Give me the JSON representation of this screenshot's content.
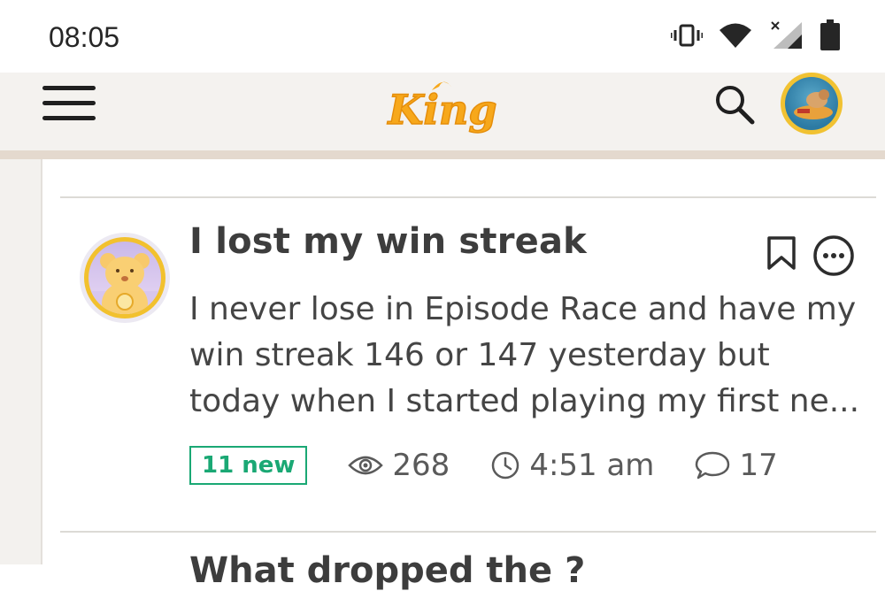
{
  "status_bar": {
    "time": "08:05",
    "icons": [
      "vibrate-icon",
      "wifi-icon",
      "cellular-no-signal-icon",
      "battery-icon"
    ]
  },
  "header": {
    "logo_text": "King",
    "menu_icon": "hamburger-icon",
    "search_icon": "search-icon",
    "avatar": "user-avatar"
  },
  "post": {
    "title": "I lost my win streak",
    "excerpt": "I never lose in Episode Race and have my win streak 146 or 147 yesterday but today when I started playing my first ne...",
    "new_badge": "11 new",
    "views": "268",
    "time": "4:51 am",
    "replies": "17",
    "icons": [
      "bookmark-icon",
      "more-options-icon",
      "eye-icon",
      "clock-icon",
      "comment-icon"
    ]
  },
  "next_post": {
    "title_peek": "What dropped the ?"
  },
  "colors": {
    "header_bg": "#f4f2ef",
    "new_badge": "#1aa874",
    "logo_orange": "#f7a81b",
    "text": "#3d3d3d"
  }
}
